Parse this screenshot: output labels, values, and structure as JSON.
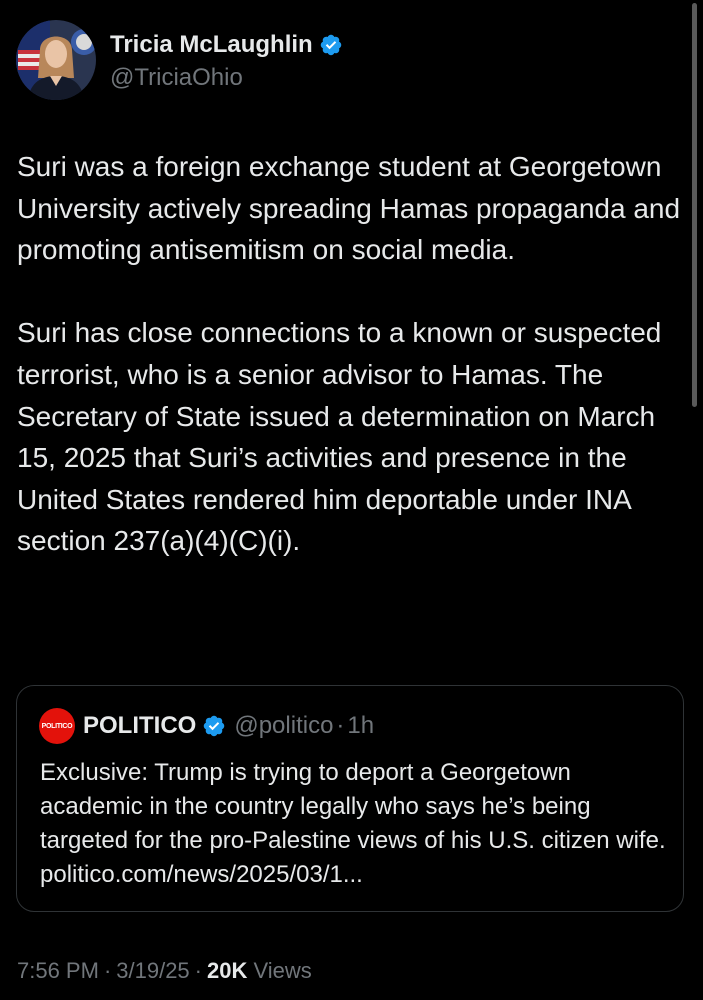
{
  "author": {
    "name": "Tricia McLaughlin",
    "handle": "@TriciaOhio",
    "verified": true
  },
  "post": {
    "paragraphs": [
      "Suri was a foreign exchange student at Georgetown University actively spreading Hamas propaganda and promoting antisemitism on social media.",
      "Suri has close connections to a known or suspected terrorist, who is a senior advisor to Hamas. The Secretary of State issued a determination on March 15, 2025 that Suri’s activities and presence in the United States rendered him deportable under INA section 237(a)(4)(C)(i)."
    ]
  },
  "quote": {
    "logo_text": "POLITICO",
    "name": "POLITICO",
    "handle": "@politico",
    "separator": "·",
    "time": "1h",
    "text": "Exclusive: Trump is trying to deport a Georgetown academic in the country legally who says he’s being targeted for the pro-Palestine views of his U.S. citizen wife. politico.com/news/2025/03/1..."
  },
  "meta": {
    "time": "7:56 PM",
    "separator": "·",
    "date": "3/19/25",
    "views_count": "20K",
    "views_label": "Views"
  },
  "colors": {
    "background": "#000000",
    "text_primary": "#e7e9ea",
    "text_secondary": "#71767b",
    "verified_blue": "#1d9bf0",
    "border": "#2f3336",
    "politico_red": "#e3120b"
  },
  "icons": {
    "verified": "verified-badge-icon",
    "politico_logo": "politico-logo-icon"
  }
}
